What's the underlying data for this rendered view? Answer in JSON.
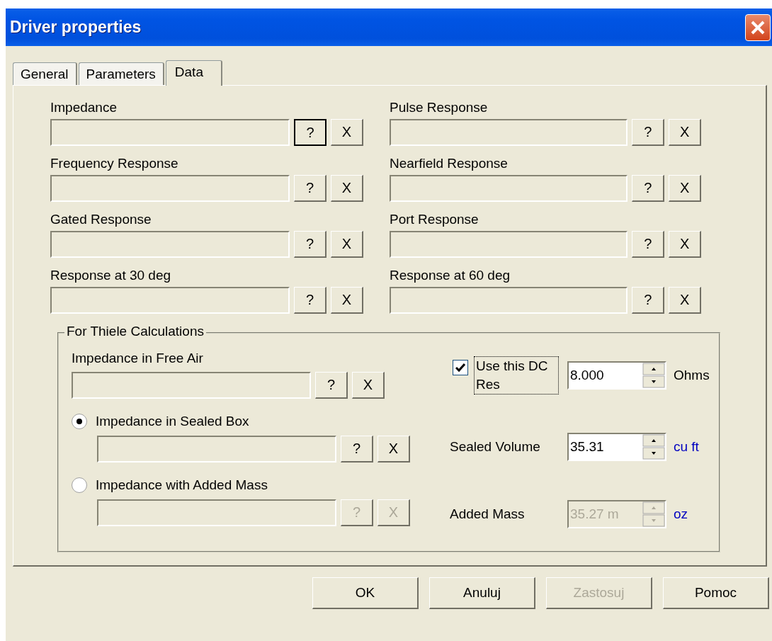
{
  "window": {
    "title": "Driver properties"
  },
  "tabs": [
    {
      "label": "General",
      "selected": false
    },
    {
      "label": "Parameters",
      "selected": false
    },
    {
      "label": "Data",
      "selected": true
    }
  ],
  "file_fields": [
    {
      "label": "Impedance",
      "help": "?",
      "clear": "X",
      "disabled": false,
      "focused": true
    },
    {
      "label": "Pulse Response",
      "help": "?",
      "clear": "X",
      "disabled": false,
      "focused": false
    },
    {
      "label": "Frequency Response",
      "help": "?",
      "clear": "X",
      "disabled": false,
      "focused": false
    },
    {
      "label": "Nearfield Response",
      "help": "?",
      "clear": "X",
      "disabled": false,
      "focused": false
    },
    {
      "label": "Gated Response",
      "help": "?",
      "clear": "X",
      "disabled": false,
      "focused": false
    },
    {
      "label": "Port Response",
      "help": "?",
      "clear": "X",
      "disabled": false,
      "focused": false
    },
    {
      "label": "Response at 30 deg",
      "help": "?",
      "clear": "X",
      "disabled": false,
      "focused": false
    },
    {
      "label": "Response at 60 deg",
      "help": "?",
      "clear": "X",
      "disabled": false,
      "focused": false
    }
  ],
  "thiele": {
    "title": "For Thiele Calculations",
    "sources": [
      {
        "kind": "label",
        "label": "Impedance in Free Air",
        "help": "?",
        "clear": "X",
        "disabled": false
      },
      {
        "kind": "radio",
        "label": "Impedance in Sealed Box",
        "selected": true,
        "help": "?",
        "clear": "X",
        "disabled": false
      },
      {
        "kind": "radio",
        "label": "Impedance with Added Mass",
        "selected": false,
        "help": "?",
        "clear": "X",
        "disabled": true
      }
    ],
    "spinners": [
      {
        "kind": "checkbox",
        "label": "Use this DC Res",
        "checked": true,
        "focused": true,
        "value": "8.000",
        "unit": "Ohms",
        "color": "#000000",
        "disabled": false
      },
      {
        "kind": "label",
        "label": "Sealed Volume",
        "value": "35.31",
        "unit": "cu ft",
        "color": "#0000c0",
        "disabled": false
      },
      {
        "kind": "label",
        "label": "Added Mass",
        "value": "35.27 m",
        "unit": "oz",
        "color": "#0000c0",
        "disabled": true
      }
    ]
  },
  "buttons": [
    {
      "label": "OK",
      "disabled": false
    },
    {
      "label": "Anuluj",
      "disabled": false
    },
    {
      "label": "Zastosuj",
      "disabled": true
    },
    {
      "label": "Pomoc",
      "disabled": false
    }
  ]
}
